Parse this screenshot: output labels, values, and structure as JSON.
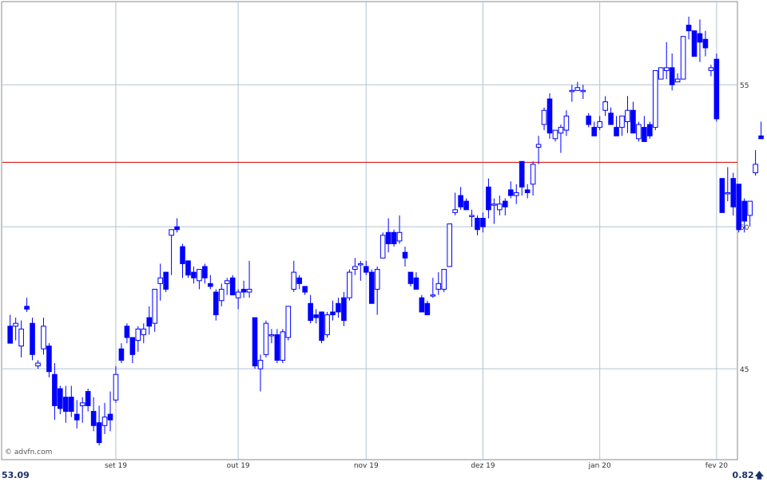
{
  "watermark": "© advfn.com",
  "footer": {
    "last_price": "53.09",
    "change": "0.82"
  },
  "icons": {
    "change_direction": "up-arrow-icon"
  },
  "colors": {
    "candle": "#0000ff",
    "grid": "#b4c4d0",
    "reference": "#cc0000",
    "frame": "#888888"
  },
  "chart_data": {
    "type": "candlestick",
    "title": "",
    "xlabel": "",
    "ylabel": "",
    "ylim": [
      41.8,
      57.9
    ],
    "y_ticks": [
      45,
      50,
      55
    ],
    "x_ticks": [
      {
        "label": "set 19",
        "index": 19
      },
      {
        "label": "out 19",
        "index": 41
      },
      {
        "label": "nov 19",
        "index": 64
      },
      {
        "label": "dez 19",
        "index": 85
      },
      {
        "label": "jan 20",
        "index": 106
      },
      {
        "label": "fev 20",
        "index": 127
      }
    ],
    "reference_line": 52.27,
    "grid": true,
    "ohlc": [
      [
        46.5,
        46.9,
        45.9,
        45.9
      ],
      [
        46.5,
        46.8,
        46.0,
        46.6
      ],
      [
        45.8,
        46.7,
        45.4,
        46.4
      ],
      [
        47.2,
        47.5,
        47.0,
        47.1
      ],
      [
        46.6,
        46.8,
        45.3,
        45.5
      ],
      [
        45.1,
        45.3,
        45.0,
        45.2
      ],
      [
        45.7,
        46.8,
        45.5,
        46.5
      ],
      [
        45.8,
        45.9,
        44.7,
        44.9
      ],
      [
        44.8,
        45.2,
        43.2,
        43.7
      ],
      [
        44.3,
        44.4,
        43.4,
        43.6
      ],
      [
        44.0,
        44.4,
        43.1,
        43.5
      ],
      [
        44.0,
        44.4,
        43.3,
        43.5
      ],
      [
        43.4,
        43.9,
        42.9,
        43.2
      ],
      [
        43.7,
        44.0,
        43.1,
        43.8
      ],
      [
        44.2,
        44.3,
        43.5,
        43.7
      ],
      [
        43.5,
        44.0,
        42.8,
        43.0
      ],
      [
        43.1,
        43.7,
        42.3,
        42.4
      ],
      [
        43.0,
        43.8,
        42.7,
        43.3
      ],
      [
        43.4,
        44.2,
        42.8,
        43.2
      ],
      [
        43.9,
        45.1,
        43.8,
        44.8
      ],
      [
        45.7,
        45.9,
        45.2,
        45.3
      ],
      [
        46.5,
        46.6,
        45.9,
        46.1
      ],
      [
        46.1,
        46.1,
        45.2,
        45.5
      ],
      [
        46.0,
        46.5,
        45.6,
        46.4
      ],
      [
        46.2,
        46.6,
        45.9,
        46.4
      ],
      [
        46.8,
        47.2,
        46.2,
        46.5
      ],
      [
        46.6,
        47.7,
        46.3,
        47.8
      ],
      [
        48.0,
        48.7,
        47.4,
        48.2
      ],
      [
        48.4,
        48.4,
        47.7,
        47.8
      ],
      [
        49.7,
        49.9,
        48.3,
        49.9
      ],
      [
        50.0,
        50.3,
        49.8,
        49.9
      ],
      [
        49.3,
        49.4,
        48.2,
        48.7
      ],
      [
        48.8,
        48.8,
        48.2,
        48.3
      ],
      [
        48.4,
        48.6,
        48.0,
        48.2
      ],
      [
        48.1,
        48.4,
        47.8,
        48.5
      ],
      [
        48.6,
        48.7,
        48.0,
        48.2
      ],
      [
        48.0,
        48.3,
        47.8,
        47.9
      ],
      [
        47.7,
        47.8,
        46.7,
        46.9
      ],
      [
        47.4,
        48.0,
        47.2,
        47.8
      ],
      [
        48.0,
        48.2,
        47.6,
        48.1
      ],
      [
        48.2,
        48.3,
        47.6,
        47.6
      ],
      [
        47.5,
        47.8,
        47.1,
        47.7
      ],
      [
        47.8,
        48.1,
        47.5,
        47.7
      ],
      [
        47.7,
        48.8,
        47.5,
        47.8
      ],
      [
        46.8,
        46.8,
        45.0,
        45.1
      ],
      [
        45.0,
        45.5,
        44.2,
        45.3
      ],
      [
        45.5,
        46.7,
        45.4,
        46.6
      ],
      [
        46.2,
        46.4,
        45.9,
        46.2
      ],
      [
        46.2,
        46.4,
        45.2,
        45.3
      ],
      [
        45.3,
        46.4,
        45.2,
        46.3
      ],
      [
        46.1,
        47.2,
        46.0,
        47.2
      ],
      [
        47.8,
        48.8,
        47.7,
        48.4
      ],
      [
        48.2,
        48.3,
        47.8,
        48.0
      ],
      [
        47.9,
        47.9,
        47.6,
        47.7
      ],
      [
        47.3,
        47.6,
        46.6,
        46.7
      ],
      [
        46.9,
        47.1,
        46.6,
        46.8
      ],
      [
        47.0,
        47.0,
        45.9,
        46.0
      ],
      [
        46.2,
        47.0,
        46.1,
        46.9
      ],
      [
        47.0,
        47.4,
        46.7,
        46.9
      ],
      [
        47.3,
        47.5,
        46.8,
        47.0
      ],
      [
        47.5,
        47.7,
        46.5,
        46.7
      ],
      [
        47.5,
        48.5,
        47.4,
        48.4
      ],
      [
        48.5,
        48.9,
        48.3,
        48.6
      ],
      [
        48.7,
        48.8,
        48.1,
        48.7
      ],
      [
        48.6,
        48.8,
        48.3,
        48.4
      ],
      [
        48.4,
        48.5,
        47.3,
        47.3
      ],
      [
        47.8,
        48.6,
        46.9,
        48.5
      ],
      [
        48.9,
        49.8,
        48.9,
        49.7
      ],
      [
        49.8,
        50.3,
        49.1,
        49.4
      ],
      [
        49.8,
        49.9,
        49.3,
        49.4
      ],
      [
        49.5,
        50.4,
        49.4,
        49.8
      ],
      [
        49.1,
        49.3,
        48.6,
        48.9
      ],
      [
        48.4,
        48.4,
        47.9,
        48.0
      ],
      [
        48.2,
        48.4,
        47.8,
        47.8
      ],
      [
        47.5,
        47.6,
        47.0,
        47.0
      ],
      [
        47.3,
        47.4,
        46.9,
        46.9
      ],
      [
        47.6,
        48.2,
        47.5,
        47.6
      ],
      [
        47.8,
        48.4,
        47.6,
        48.0
      ],
      [
        47.8,
        48.5,
        47.7,
        48.5
      ],
      [
        48.6,
        50.1,
        48.6,
        50.1
      ],
      [
        50.5,
        51.2,
        50.4,
        50.6
      ],
      [
        51.1,
        51.4,
        50.6,
        50.7
      ],
      [
        50.9,
        51.0,
        50.7,
        50.6
      ],
      [
        50.4,
        50.6,
        50.0,
        50.4
      ],
      [
        50.3,
        50.4,
        49.7,
        49.9
      ],
      [
        50.3,
        50.5,
        49.8,
        50.0
      ],
      [
        51.4,
        51.7,
        50.3,
        50.6
      ],
      [
        50.8,
        51.0,
        50.1,
        50.8
      ],
      [
        50.6,
        51.1,
        50.4,
        50.8
      ],
      [
        50.9,
        51.0,
        50.4,
        50.7
      ],
      [
        51.3,
        51.6,
        51.0,
        51.1
      ],
      [
        51.1,
        51.5,
        50.8,
        51.2
      ],
      [
        52.3,
        52.3,
        51.1,
        51.4
      ],
      [
        51.3,
        51.5,
        51.0,
        51.2
      ],
      [
        51.5,
        52.3,
        51.1,
        52.2
      ],
      [
        52.8,
        53.2,
        52.2,
        52.9
      ],
      [
        53.6,
        54.2,
        53.4,
        54.1
      ],
      [
        54.5,
        54.7,
        53.1,
        53.3
      ],
      [
        53.1,
        53.3,
        53.0,
        53.4
      ],
      [
        53.3,
        53.6,
        52.6,
        53.5
      ],
      [
        53.4,
        54.1,
        53.2,
        53.9
      ],
      [
        54.8,
        55.0,
        54.4,
        54.8
      ],
      [
        54.8,
        55.1,
        54.8,
        54.9
      ],
      [
        54.8,
        55.0,
        54.5,
        54.8
      ],
      [
        53.9,
        54.0,
        53.5,
        53.6
      ],
      [
        53.5,
        53.7,
        53.4,
        53.2
      ],
      [
        53.5,
        53.9,
        53.4,
        53.7
      ],
      [
        54.1,
        54.6,
        53.9,
        54.4
      ],
      [
        54.0,
        54.2,
        53.6,
        53.6
      ],
      [
        53.5,
        53.9,
        53.2,
        53.2
      ],
      [
        53.5,
        53.9,
        53.2,
        53.9
      ],
      [
        53.7,
        54.6,
        53.3,
        54.1
      ],
      [
        54.1,
        54.4,
        53.6,
        53.3
      ],
      [
        53.1,
        53.7,
        53.0,
        53.6
      ],
      [
        53.5,
        53.9,
        53.0,
        53.0
      ],
      [
        53.6,
        53.7,
        53.1,
        53.2
      ],
      [
        53.5,
        55.5,
        53.4,
        55.5
      ],
      [
        55.2,
        55.4,
        55.3,
        55.6
      ],
      [
        55.5,
        56.5,
        55.2,
        55.6
      ],
      [
        55.6,
        56.1,
        54.8,
        55.0
      ],
      [
        55.1,
        55.4,
        55.1,
        55.2
      ],
      [
        55.2,
        56.6,
        55.6,
        56.7
      ],
      [
        57.1,
        57.4,
        56.6,
        56.9
      ],
      [
        56.9,
        56.9,
        56.0,
        56.0
      ],
      [
        56.8,
        57.3,
        55.8,
        56.5
      ],
      [
        56.6,
        56.9,
        56.0,
        56.3
      ],
      [
        55.5,
        55.7,
        55.3,
        55.6
      ],
      [
        55.9,
        56.1,
        53.7,
        53.8
      ],
      [
        51.7,
        51.7,
        50.5,
        50.5
      ],
      [
        51.2,
        52.1,
        50.9,
        51.2
      ],
      [
        51.7,
        51.9,
        50.4,
        50.7
      ],
      [
        51.5,
        51.5,
        49.8,
        49.9
      ],
      [
        50.9,
        51.0,
        49.8,
        50.2
      ],
      [
        50.4,
        50.9,
        50.0,
        50.9
      ],
      [
        51.9,
        52.7,
        51.8,
        52.2
      ],
      [
        53.2,
        53.7,
        53.2,
        53.1
      ]
    ]
  }
}
